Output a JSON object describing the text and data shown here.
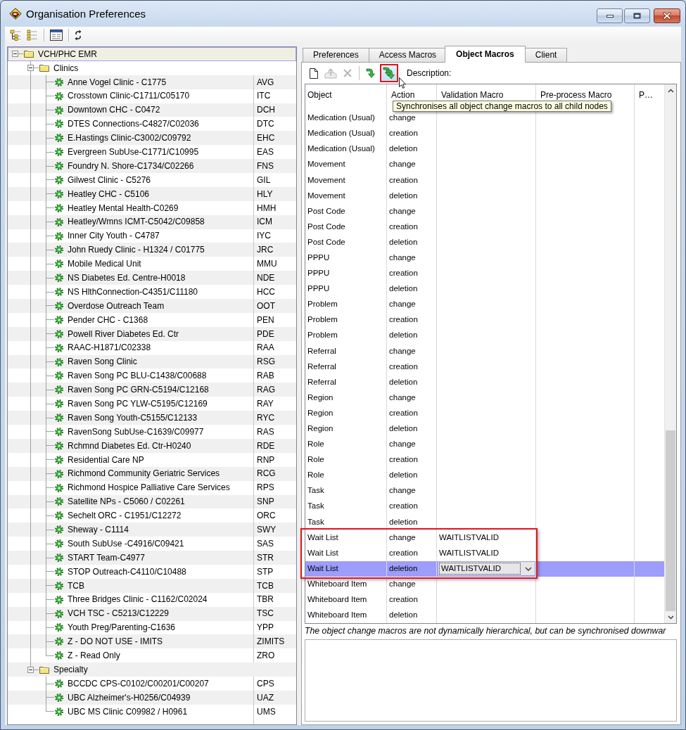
{
  "window": {
    "title": "Organisation Preferences"
  },
  "toolbar": {
    "buttons": [
      {
        "kind": "expand-tree"
      },
      {
        "kind": "collapse-tree"
      },
      {
        "kind": "separator"
      },
      {
        "kind": "form"
      },
      {
        "kind": "separator"
      },
      {
        "kind": "refresh"
      }
    ]
  },
  "tree": {
    "nodes": [
      {
        "label": "VCH/PHC EMR",
        "selected": true,
        "expanded": true,
        "children": [
          {
            "label": "Clinics",
            "selected": false,
            "expanded": true,
            "children": [
              {
                "label": "Anne Vogel Clinic - C1775",
                "code": "AVG",
                "selected": false
              },
              {
                "label": "Crosstown Clinic-C1711/C05170",
                "code": "ITC",
                "selected": false
              },
              {
                "label": "Downtown CHC - C0472",
                "code": "DCH",
                "selected": false
              },
              {
                "label": "DTES Connections-C4827/C02036",
                "code": "DTC",
                "selected": false
              },
              {
                "label": "E.Hastings Clinic-C3002/C09792",
                "code": "EHC",
                "selected": false
              },
              {
                "label": "Evergreen SubUse-C1771/C10995",
                "code": "EAS",
                "selected": false
              },
              {
                "label": "Foundry N. Shore-C1734/C02266",
                "code": "FNS",
                "selected": false
              },
              {
                "label": "Gilwest Clinic - C5276",
                "code": "GIL",
                "selected": false
              },
              {
                "label": "Heatley CHC - C5106",
                "code": "HLY",
                "selected": false
              },
              {
                "label": "Heatley Mental Health-C0269",
                "code": "HMH",
                "selected": false
              },
              {
                "label": "Heatley/Wmns ICMT-C5042/C09858",
                "code": "ICM",
                "selected": false
              },
              {
                "label": "Inner City Youth - C4787",
                "code": "IYC",
                "selected": false
              },
              {
                "label": "John Ruedy Clinic - H1324 / C01775",
                "code": "JRC",
                "selected": false
              },
              {
                "label": "Mobile Medical Unit",
                "code": "MMU",
                "selected": false
              },
              {
                "label": "NS Diabetes Ed. Centre-H0018",
                "code": "NDE",
                "selected": false
              },
              {
                "label": "NS HlthConnection-C4351/C11180",
                "code": "HCC",
                "selected": false
              },
              {
                "label": "Overdose Outreach Team",
                "code": "OOT",
                "selected": false
              },
              {
                "label": "Pender CHC - C1368",
                "code": "PEN",
                "selected": false
              },
              {
                "label": "Powell River Diabetes Ed. Ctr",
                "code": "PDE",
                "selected": false
              },
              {
                "label": "RAAC-H1871/C02338",
                "code": "RAA",
                "selected": false
              },
              {
                "label": "Raven Song Clinic",
                "code": "RSG",
                "selected": false
              },
              {
                "label": "Raven Song PC BLU-C1438/C00688",
                "code": "RAB",
                "selected": false
              },
              {
                "label": "Raven Song PC GRN-C5194/C12168",
                "code": "RAG",
                "selected": false
              },
              {
                "label": "Raven Song PC YLW-C5195/C12169",
                "code": "RAY",
                "selected": false
              },
              {
                "label": "Raven Song Youth-C5155/C12133",
                "code": "RYC",
                "selected": false
              },
              {
                "label": "RavenSong SubUse-C1639/C09977",
                "code": "RAS",
                "selected": false
              },
              {
                "label": "Rchmnd Diabetes Ed. Ctr-H0240",
                "code": "RDE",
                "selected": false
              },
              {
                "label": "Residential Care NP",
                "code": "RNP",
                "selected": false
              },
              {
                "label": "Richmond Community Geriatric Services",
                "code": "RCG",
                "selected": false
              },
              {
                "label": "Richmond Hospice Palliative Care Services",
                "code": "RPS",
                "selected": false
              },
              {
                "label": "Satellite NPs - C5060 / C02261",
                "code": "SNP",
                "selected": false
              },
              {
                "label": "Sechelt ORC - C1951/C12272",
                "code": "ORC",
                "selected": false
              },
              {
                "label": "Sheway - C1114",
                "code": "SWY",
                "selected": false
              },
              {
                "label": "South SubUse -C4916/C09421",
                "code": "SAS",
                "selected": false
              },
              {
                "label": "START Team-C4977",
                "code": "STR",
                "selected": false
              },
              {
                "label": "STOP Outreach-C4110/C10488",
                "code": "STP",
                "selected": false
              },
              {
                "label": "TCB",
                "code": "TCB",
                "selected": false
              },
              {
                "label": "Three Bridges Clinic - C1162/C02024",
                "code": "TBR",
                "selected": false
              },
              {
                "label": "VCH TSC - C5213/C12229",
                "code": "TSC",
                "selected": false
              },
              {
                "label": "Youth Preg/Parenting-C1636",
                "code": "YPP",
                "selected": false
              },
              {
                "label": "Z - DO NOT USE - IMITS",
                "code": "ZIMITS",
                "selected": false
              },
              {
                "label": "Z - Read Only",
                "code": "ZRO",
                "selected": false
              }
            ]
          },
          {
            "label": "Specialty",
            "selected": false,
            "expanded": true,
            "children": [
              {
                "label": "BCCDC CPS-C0102/C00201/C00207",
                "code": "CPS",
                "selected": false
              },
              {
                "label": "UBC Alzheimer's-H0256/C04939",
                "code": "UAZ",
                "selected": false
              },
              {
                "label": "UBC MS Clinic C09982 / H0961",
                "code": "UMS",
                "selected": false
              }
            ]
          }
        ]
      }
    ]
  },
  "tabs": [
    {
      "label": "Preferences",
      "selected": false
    },
    {
      "label": "Access Macros",
      "selected": false
    },
    {
      "label": "Object Macros",
      "selected": true
    },
    {
      "label": "Client",
      "selected": false
    }
  ],
  "object_toolbar": {
    "buttons": [
      {
        "kind": "new",
        "disabled": false,
        "hovered": false,
        "highlighted": false
      },
      {
        "kind": "upload",
        "disabled": true,
        "hovered": false,
        "highlighted": false
      },
      {
        "kind": "delete",
        "disabled": true,
        "hovered": false,
        "highlighted": false
      },
      {
        "kind": "separator"
      },
      {
        "kind": "sync",
        "disabled": false,
        "hovered": false,
        "highlighted": false
      },
      {
        "kind": "sync-all",
        "disabled": false,
        "hovered": true,
        "highlighted": true,
        "tooltip": "Synchronises all object change macros to all child nodes"
      }
    ],
    "description_label": "Description:"
  },
  "table": {
    "columns": [
      "Object",
      "Action",
      "Validation Macro",
      "Pre-process Macro",
      "P…"
    ],
    "rows": [
      {
        "object": "Medication (Usual)",
        "action": "change",
        "selected": false,
        "highlighted": false
      },
      {
        "object": "Medication (Usual)",
        "action": "creation",
        "selected": false,
        "highlighted": false
      },
      {
        "object": "Medication (Usual)",
        "action": "deletion",
        "selected": false,
        "highlighted": false
      },
      {
        "object": "Movement",
        "action": "change",
        "selected": false,
        "highlighted": false
      },
      {
        "object": "Movement",
        "action": "creation",
        "selected": false,
        "highlighted": false
      },
      {
        "object": "Movement",
        "action": "deletion",
        "selected": false,
        "highlighted": false
      },
      {
        "object": "Post Code",
        "action": "change",
        "selected": false,
        "highlighted": false
      },
      {
        "object": "Post Code",
        "action": "creation",
        "selected": false,
        "highlighted": false
      },
      {
        "object": "Post Code",
        "action": "deletion",
        "selected": false,
        "highlighted": false
      },
      {
        "object": "PPPU",
        "action": "change",
        "selected": false,
        "highlighted": false
      },
      {
        "object": "PPPU",
        "action": "creation",
        "selected": false,
        "highlighted": false
      },
      {
        "object": "PPPU",
        "action": "deletion",
        "selected": false,
        "highlighted": false
      },
      {
        "object": "Problem",
        "action": "change",
        "selected": false,
        "highlighted": false
      },
      {
        "object": "Problem",
        "action": "creation",
        "selected": false,
        "highlighted": false
      },
      {
        "object": "Problem",
        "action": "deletion",
        "selected": false,
        "highlighted": false
      },
      {
        "object": "Referral",
        "action": "change",
        "selected": false,
        "highlighted": false
      },
      {
        "object": "Referral",
        "action": "creation",
        "selected": false,
        "highlighted": false
      },
      {
        "object": "Referral",
        "action": "deletion",
        "selected": false,
        "highlighted": false
      },
      {
        "object": "Region",
        "action": "change",
        "selected": false,
        "highlighted": false
      },
      {
        "object": "Region",
        "action": "creation",
        "selected": false,
        "highlighted": false
      },
      {
        "object": "Region",
        "action": "deletion",
        "selected": false,
        "highlighted": false
      },
      {
        "object": "Role",
        "action": "change",
        "selected": false,
        "highlighted": false
      },
      {
        "object": "Role",
        "action": "creation",
        "selected": false,
        "highlighted": false
      },
      {
        "object": "Role",
        "action": "deletion",
        "selected": false,
        "highlighted": false
      },
      {
        "object": "Task",
        "action": "change",
        "selected": false,
        "highlighted": false
      },
      {
        "object": "Task",
        "action": "creation",
        "selected": false,
        "highlighted": false
      },
      {
        "object": "Task",
        "action": "deletion",
        "selected": false,
        "highlighted": false
      },
      {
        "object": "Wait List",
        "action": "change",
        "validation_macro": "WAITLISTVALID",
        "selected": false,
        "highlighted": true
      },
      {
        "object": "Wait List",
        "action": "creation",
        "validation_macro": "WAITLISTVALID",
        "selected": false,
        "highlighted": true
      },
      {
        "object": "Wait List",
        "action": "deletion",
        "validation_macro": "WAITLISTVALID",
        "selected": true,
        "highlighted": true
      },
      {
        "object": "Whiteboard Item",
        "action": "change",
        "selected": false,
        "highlighted": false
      },
      {
        "object": "Whiteboard Item",
        "action": "creation",
        "selected": false,
        "highlighted": false
      },
      {
        "object": "Whiteboard Item",
        "action": "deletion",
        "selected": false,
        "highlighted": false
      }
    ]
  },
  "note": "The object change macros are not dynamically hierarchical, but can be synchronised downwar"
}
